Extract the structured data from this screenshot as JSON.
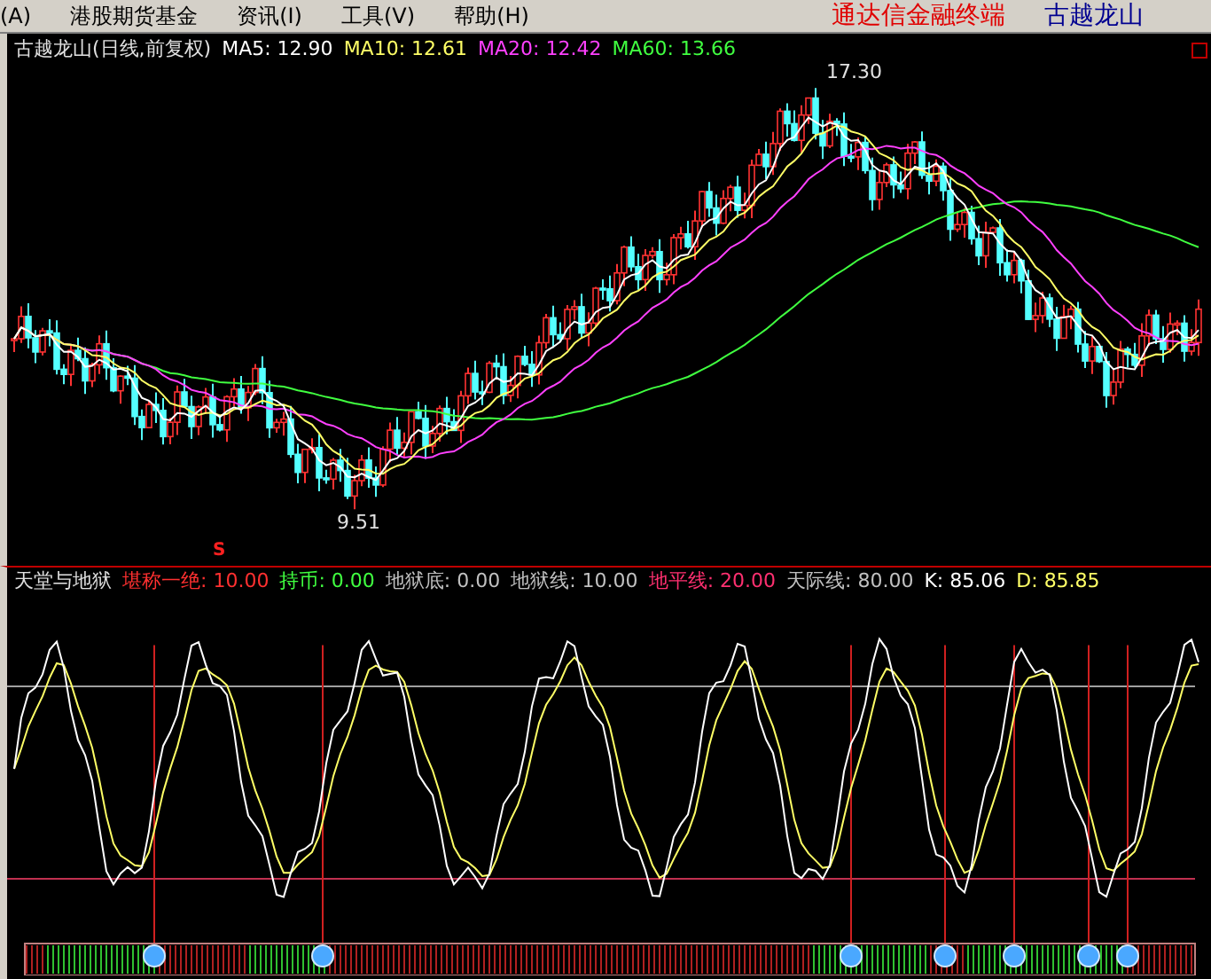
{
  "menu": {
    "items": [
      {
        "label": "(A)"
      },
      {
        "label": "港股期货基金"
      },
      {
        "label": "资讯(I)"
      },
      {
        "label": "工具(V)"
      },
      {
        "label": "帮助(H)"
      }
    ],
    "brand": "通达信金融终端",
    "stock_name": "古越龙山"
  },
  "price_chart": {
    "legend": [
      {
        "text": "古越龙山(日线,前复权)",
        "color": "#e0e0e0"
      },
      {
        "text": "MA5: 12.90",
        "color": "#ffffff"
      },
      {
        "text": "MA10: 12.61",
        "color": "#ffff66"
      },
      {
        "text": "MA20: 12.42",
        "color": "#ff40ff"
      },
      {
        "text": "MA60: 13.66",
        "color": "#40ff40"
      }
    ],
    "high_label": "17.30",
    "low_label": "9.51",
    "signal_mark": "S"
  },
  "indicator": {
    "legend": [
      {
        "text": "天堂与地狱",
        "color": "#e0e0e0"
      },
      {
        "text": "堪称一绝: 10.00",
        "color": "#ff3030"
      },
      {
        "text": "持币: 0.00",
        "color": "#40ff40"
      },
      {
        "text": "地狱底: 0.00",
        "color": "#c0c0c0"
      },
      {
        "text": "地狱线: 10.00",
        "color": "#c0c0c0"
      },
      {
        "text": "地平线: 20.00",
        "color": "#ff3070"
      },
      {
        "text": "天际线: 80.00",
        "color": "#c0c0c0"
      },
      {
        "text": "K: 85.06",
        "color": "#ffffff"
      },
      {
        "text": "D: 85.85",
        "color": "#ffff66"
      }
    ]
  }
}
